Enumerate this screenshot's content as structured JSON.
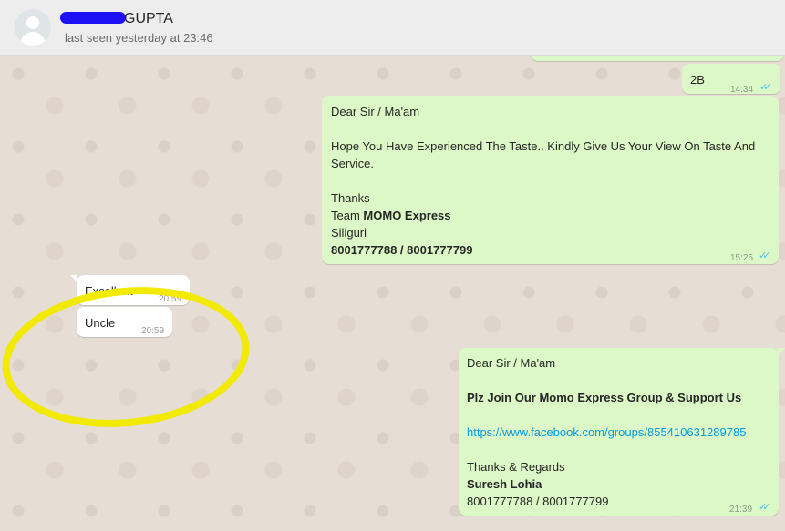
{
  "header": {
    "contact_name": "GUPTA",
    "last_seen": "last seen yesterday at 23:46"
  },
  "messages": [
    {
      "direction": "out",
      "text": "2B",
      "time": "14:34",
      "status_icon": "double-check-read-icon"
    },
    {
      "direction": "out",
      "greeting": "Dear Sir / Ma'am",
      "body": "Hope You Have Experienced The Taste.. Kindly Give Us Your View On Taste And Service.",
      "thanks": "Thanks",
      "team_prefix": "Team",
      "team_name": "MOMO Express",
      "city": "Siliguri",
      "phones": "8001777788 / 8001777799",
      "time": "15:25",
      "status_icon": "double-check-read-icon"
    },
    {
      "direction": "in",
      "text": "Excellent",
      "time": "20:59"
    },
    {
      "direction": "in",
      "text": "Uncle",
      "time": "20:59"
    },
    {
      "direction": "out",
      "greeting": "Dear Sir / Ma'am",
      "headline": "Plz Join Our Momo Express Group & Support Us",
      "link": "https://www.facebook.com/groups/855410631289785",
      "thanks": "Thanks & Regards",
      "sender": "Suresh Lohia",
      "phones": "8001777788 / 8001777799",
      "time": "21:39",
      "status_icon": "double-check-read-icon"
    }
  ],
  "annotation": {
    "highlight_color": "#f2ea00"
  },
  "colors": {
    "outgoing_bubble": "#dcf8c6",
    "incoming_bubble": "#ffffff",
    "read_ticks": "#4fc3f7",
    "header_bg": "#ededed",
    "link": "#039be5"
  }
}
